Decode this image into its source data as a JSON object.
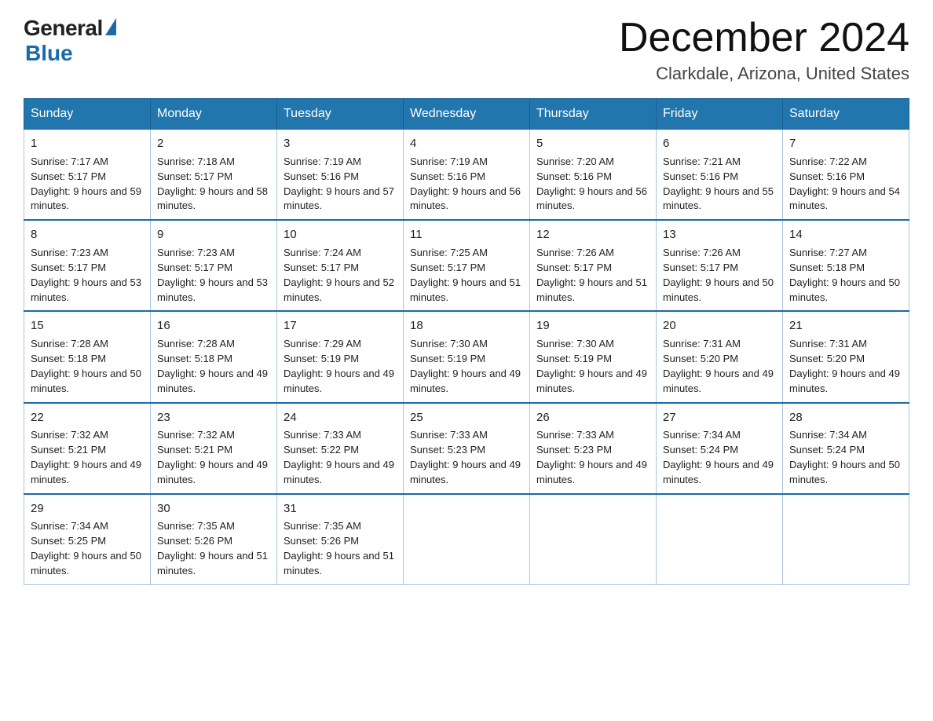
{
  "logo": {
    "general": "General",
    "blue": "Blue"
  },
  "header": {
    "month": "December 2024",
    "location": "Clarkdale, Arizona, United States"
  },
  "weekdays": [
    "Sunday",
    "Monday",
    "Tuesday",
    "Wednesday",
    "Thursday",
    "Friday",
    "Saturday"
  ],
  "weeks": [
    [
      {
        "day": "1",
        "sunrise": "7:17 AM",
        "sunset": "5:17 PM",
        "daylight": "9 hours and 59 minutes."
      },
      {
        "day": "2",
        "sunrise": "7:18 AM",
        "sunset": "5:17 PM",
        "daylight": "9 hours and 58 minutes."
      },
      {
        "day": "3",
        "sunrise": "7:19 AM",
        "sunset": "5:16 PM",
        "daylight": "9 hours and 57 minutes."
      },
      {
        "day": "4",
        "sunrise": "7:19 AM",
        "sunset": "5:16 PM",
        "daylight": "9 hours and 56 minutes."
      },
      {
        "day": "5",
        "sunrise": "7:20 AM",
        "sunset": "5:16 PM",
        "daylight": "9 hours and 56 minutes."
      },
      {
        "day": "6",
        "sunrise": "7:21 AM",
        "sunset": "5:16 PM",
        "daylight": "9 hours and 55 minutes."
      },
      {
        "day": "7",
        "sunrise": "7:22 AM",
        "sunset": "5:16 PM",
        "daylight": "9 hours and 54 minutes."
      }
    ],
    [
      {
        "day": "8",
        "sunrise": "7:23 AM",
        "sunset": "5:17 PM",
        "daylight": "9 hours and 53 minutes."
      },
      {
        "day": "9",
        "sunrise": "7:23 AM",
        "sunset": "5:17 PM",
        "daylight": "9 hours and 53 minutes."
      },
      {
        "day": "10",
        "sunrise": "7:24 AM",
        "sunset": "5:17 PM",
        "daylight": "9 hours and 52 minutes."
      },
      {
        "day": "11",
        "sunrise": "7:25 AM",
        "sunset": "5:17 PM",
        "daylight": "9 hours and 51 minutes."
      },
      {
        "day": "12",
        "sunrise": "7:26 AM",
        "sunset": "5:17 PM",
        "daylight": "9 hours and 51 minutes."
      },
      {
        "day": "13",
        "sunrise": "7:26 AM",
        "sunset": "5:17 PM",
        "daylight": "9 hours and 50 minutes."
      },
      {
        "day": "14",
        "sunrise": "7:27 AM",
        "sunset": "5:18 PM",
        "daylight": "9 hours and 50 minutes."
      }
    ],
    [
      {
        "day": "15",
        "sunrise": "7:28 AM",
        "sunset": "5:18 PM",
        "daylight": "9 hours and 50 minutes."
      },
      {
        "day": "16",
        "sunrise": "7:28 AM",
        "sunset": "5:18 PM",
        "daylight": "9 hours and 49 minutes."
      },
      {
        "day": "17",
        "sunrise": "7:29 AM",
        "sunset": "5:19 PM",
        "daylight": "9 hours and 49 minutes."
      },
      {
        "day": "18",
        "sunrise": "7:30 AM",
        "sunset": "5:19 PM",
        "daylight": "9 hours and 49 minutes."
      },
      {
        "day": "19",
        "sunrise": "7:30 AM",
        "sunset": "5:19 PM",
        "daylight": "9 hours and 49 minutes."
      },
      {
        "day": "20",
        "sunrise": "7:31 AM",
        "sunset": "5:20 PM",
        "daylight": "9 hours and 49 minutes."
      },
      {
        "day": "21",
        "sunrise": "7:31 AM",
        "sunset": "5:20 PM",
        "daylight": "9 hours and 49 minutes."
      }
    ],
    [
      {
        "day": "22",
        "sunrise": "7:32 AM",
        "sunset": "5:21 PM",
        "daylight": "9 hours and 49 minutes."
      },
      {
        "day": "23",
        "sunrise": "7:32 AM",
        "sunset": "5:21 PM",
        "daylight": "9 hours and 49 minutes."
      },
      {
        "day": "24",
        "sunrise": "7:33 AM",
        "sunset": "5:22 PM",
        "daylight": "9 hours and 49 minutes."
      },
      {
        "day": "25",
        "sunrise": "7:33 AM",
        "sunset": "5:23 PM",
        "daylight": "9 hours and 49 minutes."
      },
      {
        "day": "26",
        "sunrise": "7:33 AM",
        "sunset": "5:23 PM",
        "daylight": "9 hours and 49 minutes."
      },
      {
        "day": "27",
        "sunrise": "7:34 AM",
        "sunset": "5:24 PM",
        "daylight": "9 hours and 49 minutes."
      },
      {
        "day": "28",
        "sunrise": "7:34 AM",
        "sunset": "5:24 PM",
        "daylight": "9 hours and 50 minutes."
      }
    ],
    [
      {
        "day": "29",
        "sunrise": "7:34 AM",
        "sunset": "5:25 PM",
        "daylight": "9 hours and 50 minutes."
      },
      {
        "day": "30",
        "sunrise": "7:35 AM",
        "sunset": "5:26 PM",
        "daylight": "9 hours and 51 minutes."
      },
      {
        "day": "31",
        "sunrise": "7:35 AM",
        "sunset": "5:26 PM",
        "daylight": "9 hours and 51 minutes."
      },
      null,
      null,
      null,
      null
    ]
  ]
}
